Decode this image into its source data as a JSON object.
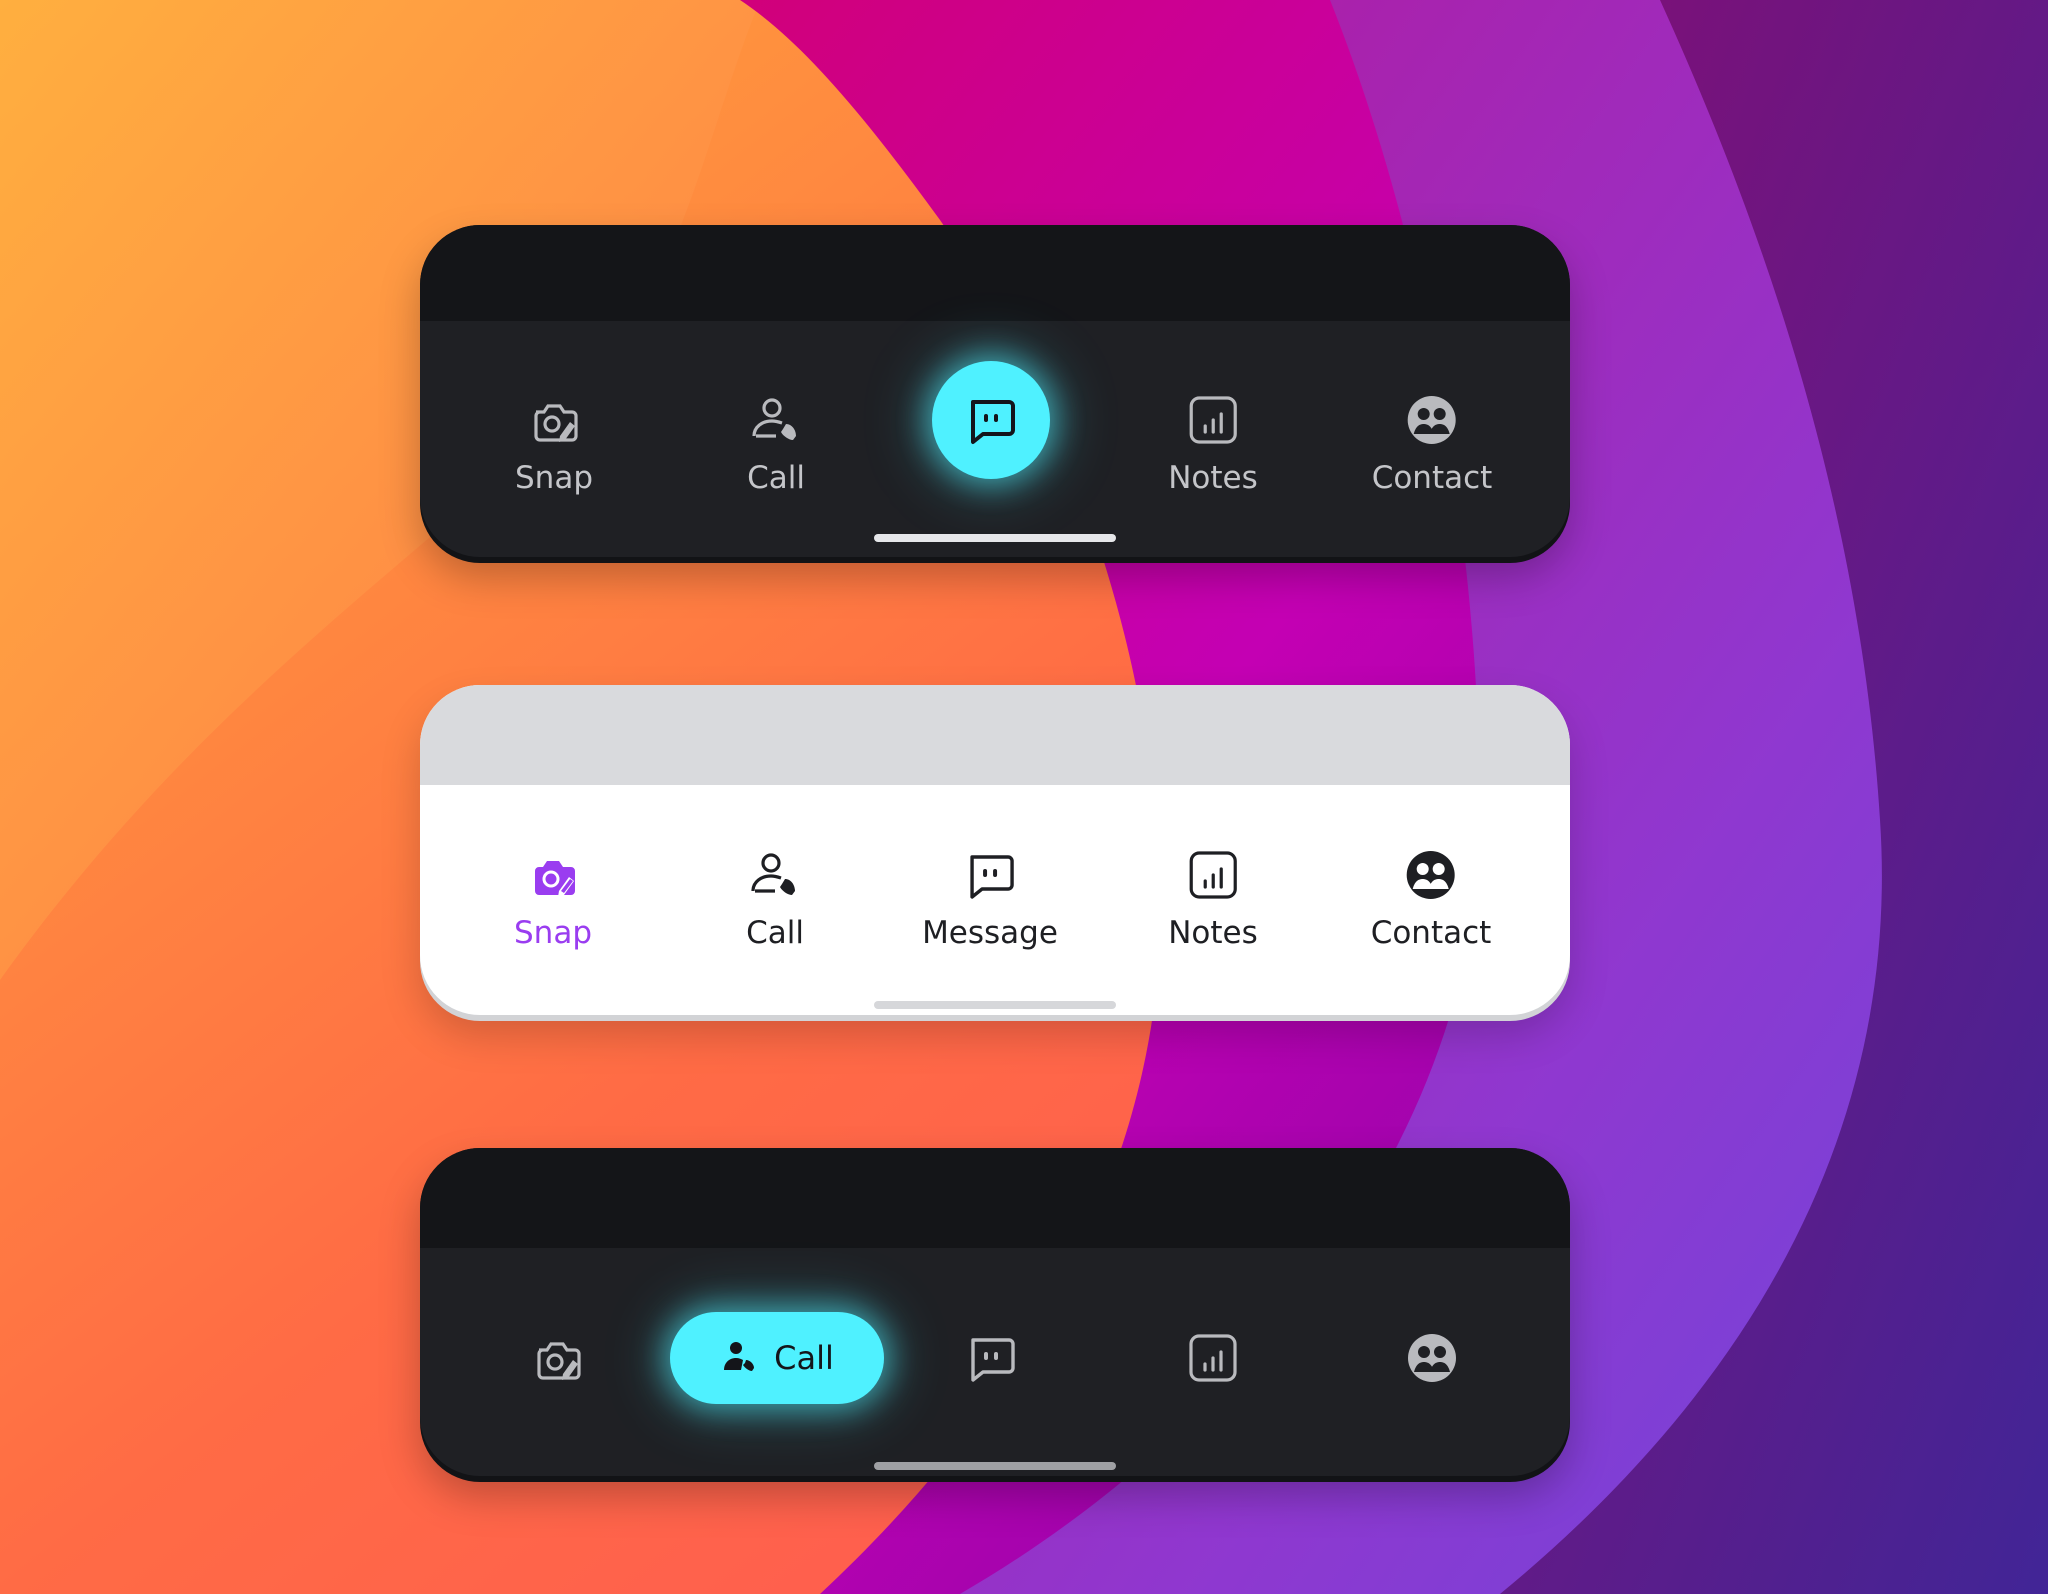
{
  "colors": {
    "dark_bar": "#1f2024",
    "dark_strip": "#141518",
    "light_bar": "#ffffff",
    "light_strip": "#d9dadd",
    "accent_cyan": "#4ff1ff",
    "accent_purple": "#9a3df0",
    "dark_label": "#c4c5c9",
    "light_label": "#1e1f23"
  },
  "bar1": {
    "theme": "dark",
    "active": "message",
    "tabs": [
      {
        "id": "snap",
        "label": "Snap",
        "icon": "camera-edit-icon"
      },
      {
        "id": "call",
        "label": "Call",
        "icon": "user-phone-icon"
      },
      {
        "id": "message",
        "label": "",
        "icon": "message-square-icon"
      },
      {
        "id": "notes",
        "label": "Notes",
        "icon": "bar-chart-square-icon"
      },
      {
        "id": "contact",
        "label": "Contact",
        "icon": "users-circle-icon"
      }
    ]
  },
  "bar2": {
    "theme": "light",
    "active": "snap",
    "tabs": [
      {
        "id": "snap",
        "label": "Snap",
        "icon": "camera-edit-icon"
      },
      {
        "id": "call",
        "label": "Call",
        "icon": "user-phone-icon"
      },
      {
        "id": "message",
        "label": "Message",
        "icon": "message-square-icon"
      },
      {
        "id": "notes",
        "label": "Notes",
        "icon": "bar-chart-square-icon"
      },
      {
        "id": "contact",
        "label": "Contact",
        "icon": "users-circle-icon"
      }
    ]
  },
  "bar3": {
    "theme": "dark",
    "active": "call",
    "tabs": [
      {
        "id": "snap",
        "label": "",
        "icon": "camera-edit-icon"
      },
      {
        "id": "call",
        "label": "Call",
        "icon": "user-phone-icon"
      },
      {
        "id": "message",
        "label": "",
        "icon": "message-square-icon"
      },
      {
        "id": "notes",
        "label": "",
        "icon": "bar-chart-square-icon"
      },
      {
        "id": "contact",
        "label": "",
        "icon": "users-circle-icon"
      }
    ]
  }
}
